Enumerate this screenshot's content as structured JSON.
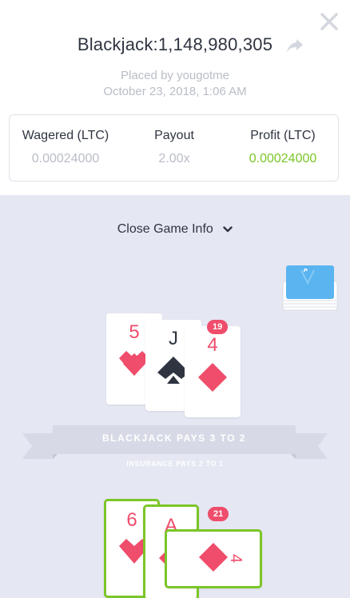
{
  "header": {
    "title": "Blackjack:1,148,980,305",
    "placed_by": "Placed by yougotme",
    "date": "October 23, 2018, 1:06 AM"
  },
  "stats": [
    {
      "label": "Wagered (LTC)",
      "value": "0.00024000"
    },
    {
      "label": "Payout",
      "value": "2.00x"
    },
    {
      "label": "Profit (LTC)",
      "value": "0.00024000"
    }
  ],
  "game": {
    "toggle_label": "Close Game Info",
    "banner_text": "BLACKJACK PAYS 3 TO 2",
    "insurance_text": "INSURANCE PAYS 2 TO 1",
    "dealer": {
      "total": "19",
      "cards": [
        {
          "rank": "5",
          "suit": "hearts"
        },
        {
          "rank": "J",
          "suit": "spades"
        },
        {
          "rank": "4",
          "suit": "diamonds"
        }
      ]
    },
    "player": {
      "total": "21",
      "cards": [
        {
          "rank": "6",
          "suit": "hearts"
        },
        {
          "rank": "A",
          "suit": "diamonds"
        },
        {
          "rank": "4",
          "suit": "diamonds"
        }
      ]
    }
  },
  "colors": {
    "accent_green": "#7bc628",
    "card_red": "#ef4d6b",
    "text_dark": "#2f3441",
    "text_muted": "#b9bdc6",
    "game_bg": "#e5e7f2",
    "deck_blue": "#5ab4f0"
  },
  "icons": {
    "close": "close-icon",
    "share": "share-icon",
    "toggle": "chevron-down-icon",
    "deck": "card-deck-icon"
  }
}
